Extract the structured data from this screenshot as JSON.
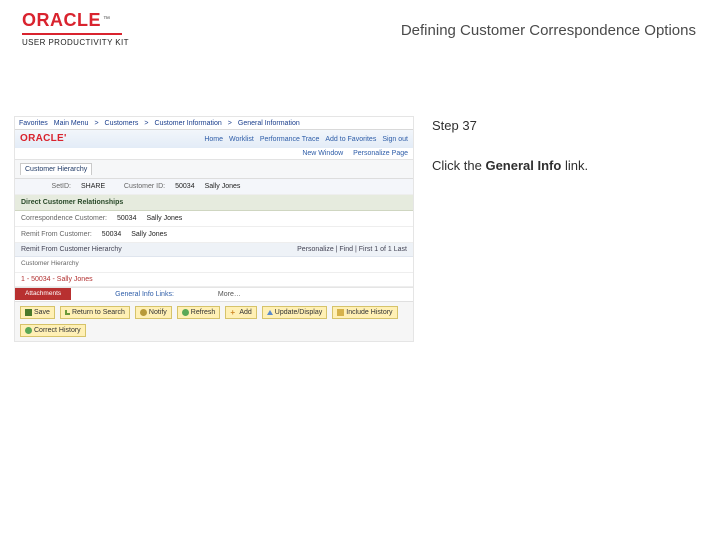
{
  "brand": {
    "name": "ORACLE",
    "tm": "™",
    "sub": "USER PRODUCTIVITY KIT"
  },
  "title": "Defining Customer Correspondence Options",
  "step": {
    "label": "Step 37",
    "text_prefix": "Click the ",
    "link": "General Info",
    "text_suffix": " link."
  },
  "app": {
    "breadcrumb": [
      "Favorites",
      "Main Menu",
      "Customers",
      "Customer Information",
      "General Information"
    ],
    "topright": [
      "Home",
      "Worklist",
      "Performance Trace",
      "Add to Favorites",
      "Sign out"
    ],
    "logo": "ORACLE'",
    "subbar": {
      "win": "New Window",
      "pers": "Personalize Page"
    },
    "tabs": [
      "Customer Hierarchy"
    ],
    "info": {
      "setid_k": "SetID:",
      "setid_v": "SHARE",
      "custid_k": "Customer ID:",
      "custid_v": "50034",
      "name_v": "Sally Jones"
    },
    "direct_sect": "Direct Customer Relationships",
    "direct": {
      "corr_k": "Correspondence Customer:",
      "corr_v": "50034",
      "corr_name": "Sally Jones",
      "remit_k": "Remit From Customer:",
      "remit_v": "50034",
      "remit_name": "Sally Jones"
    },
    "grid": {
      "title": "Remit From Customer Hierarchy",
      "right": "Personalize | Find | First 1 of 1 Last",
      "col": "Customer Hierarchy",
      "row": "1 - 50034 - Sally Jones"
    },
    "redtab": {
      "chip": "Attachments",
      "label": "General Info Links:",
      "value": "More…"
    },
    "toolbar": {
      "save": "Save",
      "ret": "Return to Search",
      "notify": "Notify",
      "refresh": "Refresh",
      "add": "Add",
      "upd": "Update/Display",
      "hist": "Include History",
      "corr": "Correct History"
    }
  }
}
